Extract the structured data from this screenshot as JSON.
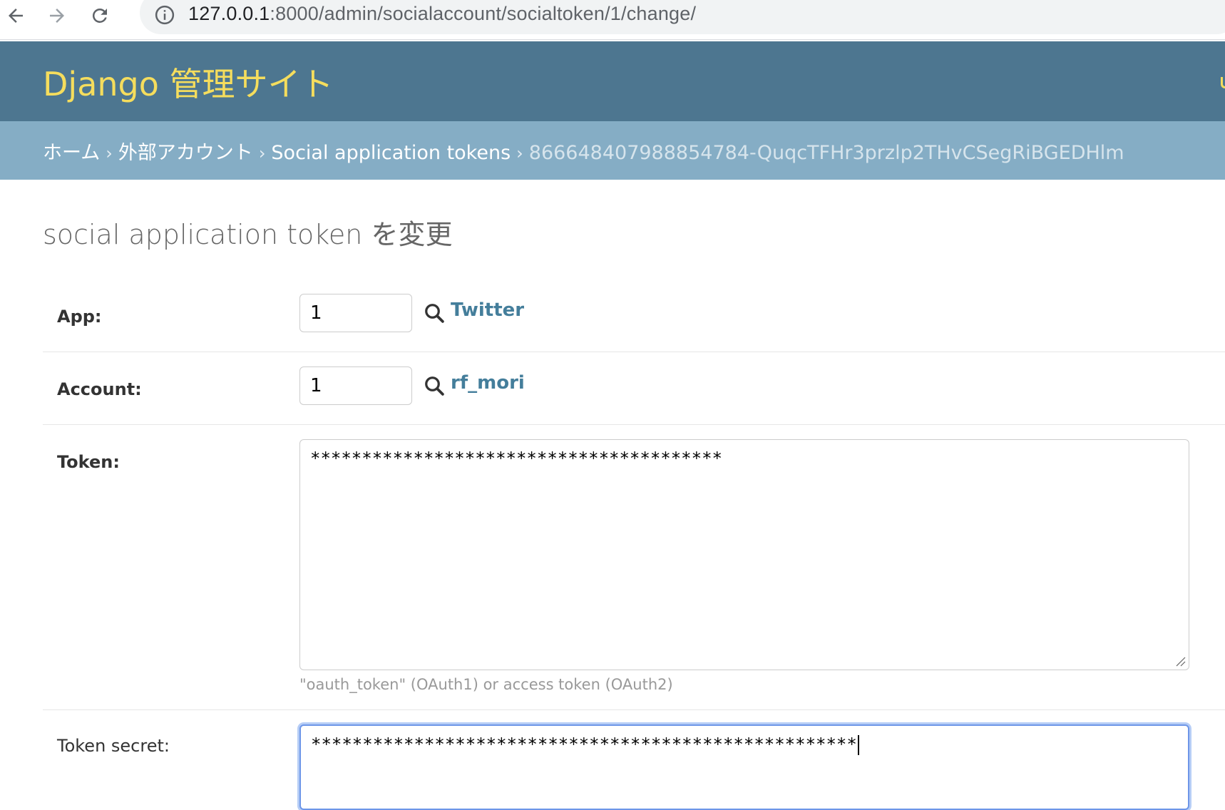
{
  "browser": {
    "url_host": "127.0.0.1",
    "url_path": ":8000/admin/socialaccount/socialtoken/1/change/"
  },
  "header": {
    "brand": "Django 管理サイト"
  },
  "breadcrumbs": {
    "home": "ホーム",
    "app": "外部アカウント",
    "model": "Social application tokens",
    "current": "866648407988854784-QuqcTFHr3przlp2THvCSegRiBGEDHlm",
    "separator": "›"
  },
  "content": {
    "title": "social application token を変更"
  },
  "form": {
    "app": {
      "label": "App:",
      "value": "1",
      "related": "Twitter"
    },
    "account": {
      "label": "Account:",
      "value": "1",
      "related": "rf_mori"
    },
    "token": {
      "label": "Token:",
      "value": "****************************************",
      "help": "\"oauth_token\" (OAuth1) or access token (OAuth2)"
    },
    "token_secret": {
      "label": "Token secret:",
      "value": "*****************************************************"
    }
  },
  "colors": {
    "header_bg": "#4d7690",
    "brand": "#f5dd5d",
    "breadcrumbs_bg": "#85adc5",
    "link": "#447e9b"
  }
}
